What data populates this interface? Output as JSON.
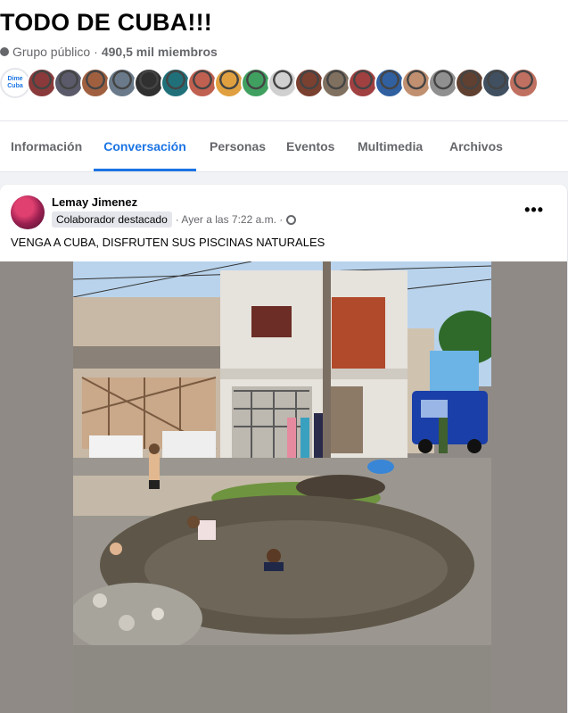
{
  "group": {
    "title": "TODO DE CUBA!!!",
    "privacy": "Grupo público",
    "separator": "·",
    "members": "490,5 mil miembros",
    "globe_icon": "globe-icon",
    "member_avatar_colors": [
      "#f4c430",
      "#8a3a3a",
      "#5a5a6a",
      "#a06040",
      "#6a7a8a",
      "#303030",
      "#20707a",
      "#c06050",
      "#e0a040",
      "#40a060",
      "#d0d0d0",
      "#7a4030",
      "#807060",
      "#a04040",
      "#3060a0",
      "#c09070",
      "#909090",
      "#604030",
      "#405060",
      "#c07060"
    ],
    "first_avatar_text": "Dime Cuba"
  },
  "tabs": [
    {
      "label": "Información",
      "active": false
    },
    {
      "label": "Conversación",
      "active": true
    },
    {
      "label": "Personas",
      "active": false
    },
    {
      "label": "Eventos",
      "active": false
    },
    {
      "label": "Multimedia",
      "active": false
    },
    {
      "label": "Archivos",
      "active": false
    }
  ],
  "post": {
    "author": "Lemay Jimenez",
    "badge": "Colaborador destacado",
    "time": "· Ayer a las 7:22 a.m. ·",
    "more_icon": "•••",
    "text": "VENGA A CUBA, DISFRUTEN SUS PISCINAS NATURALES"
  },
  "colors": {
    "accent": "#1b74e4",
    "muted": "#65676b",
    "background": "#f0f2f5"
  }
}
